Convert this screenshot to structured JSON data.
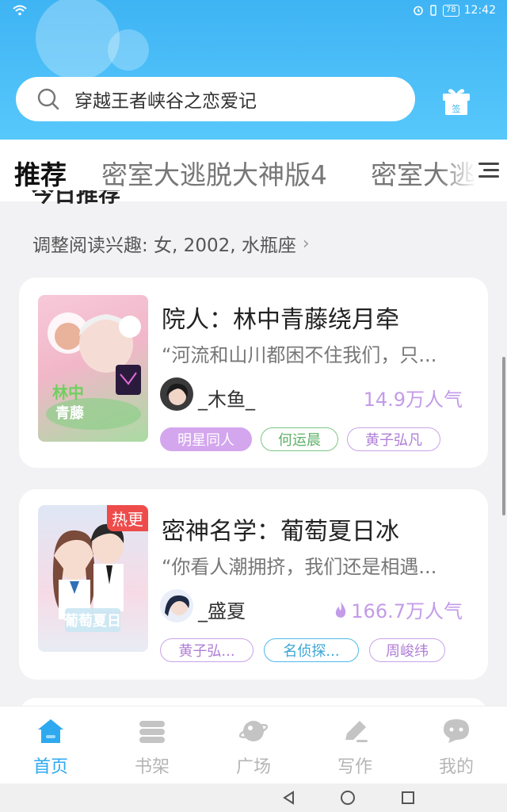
{
  "status_bar": {
    "time": "12:42",
    "battery": "78"
  },
  "search": {
    "placeholder": "穿越王者峡谷之恋爱记"
  },
  "header": {
    "gift_label": "签"
  },
  "tabs": [
    {
      "label": "推荐"
    },
    {
      "label": "密室大逃脱大神版4"
    },
    {
      "label": "密室大逃脱"
    }
  ],
  "section": {
    "title": "今日推荐",
    "interest_text": "调整阅读兴趣: 女, 2002, 水瓶座"
  },
  "books": [
    {
      "title": "院人：林中青藤绕月牵",
      "excerpt": "“河流和山川都困不住我们，只...",
      "author": "_木鱼_",
      "popularity": "14.9万人气",
      "tags": [
        "明星同人",
        "何运晨",
        "黄子弘凡"
      ],
      "hot_badge": ""
    },
    {
      "title": "密神名学：葡萄夏日冰",
      "excerpt": "“你看人潮拥挤，我们还是相遇...",
      "author": "_盛夏",
      "popularity": "166.7万人气",
      "tags": [
        "黄子弘...",
        "名侦探...",
        "周峻纬"
      ],
      "hot_badge": "热更"
    }
  ],
  "bottom_nav": [
    {
      "label": "首页",
      "icon": "home-icon"
    },
    {
      "label": "书架",
      "icon": "bookshelf-icon"
    },
    {
      "label": "广场",
      "icon": "planet-icon"
    },
    {
      "label": "写作",
      "icon": "pen-icon"
    },
    {
      "label": "我的",
      "icon": "chat-bubble-icon"
    }
  ],
  "colors": {
    "accent": "#2ea9f0",
    "header": "#3fb4f4",
    "popularity": "#c39be8",
    "hot": "#ee4b4b"
  }
}
